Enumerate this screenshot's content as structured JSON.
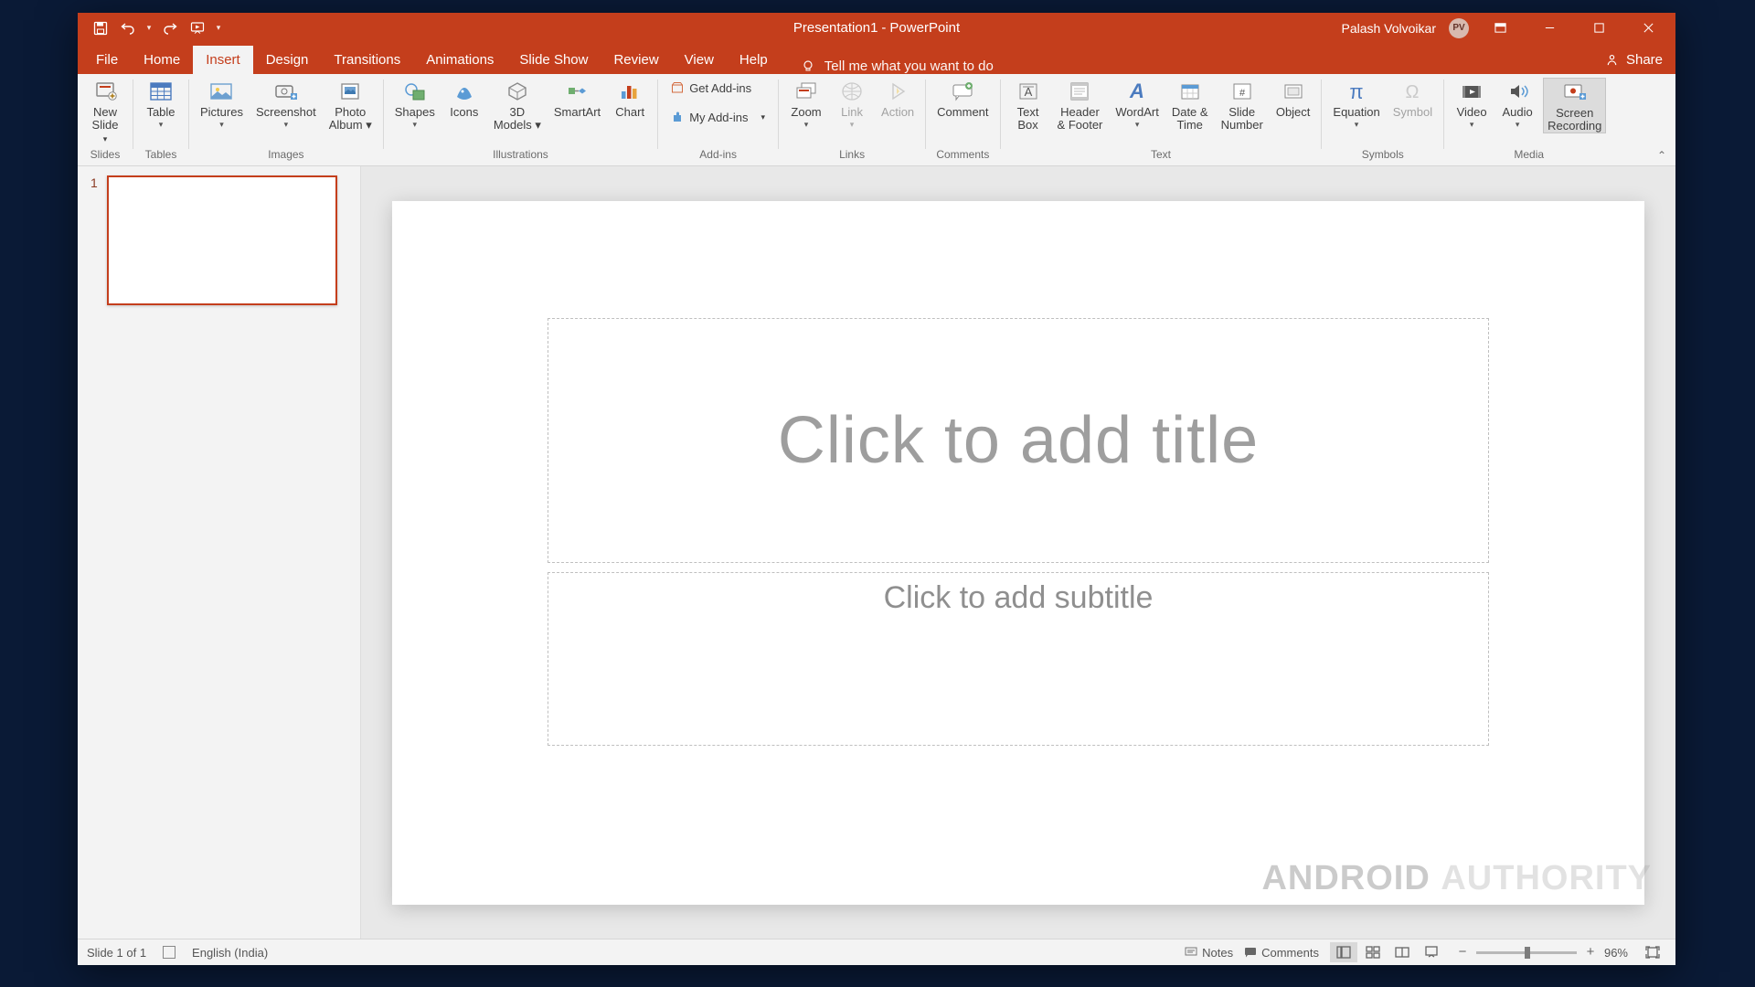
{
  "title": {
    "doc": "Presentation1",
    "sep": "-",
    "app": "PowerPoint"
  },
  "user": {
    "name": "Palash Volvoikar",
    "initials": "PV"
  },
  "qat_items": [
    "save",
    "undo",
    "redo",
    "start-from-beginning"
  ],
  "tabs": [
    "File",
    "Home",
    "Insert",
    "Design",
    "Transitions",
    "Animations",
    "Slide Show",
    "Review",
    "View",
    "Help"
  ],
  "tellme": "Tell me what you want to do",
  "share": "Share",
  "ribbon": {
    "slides": {
      "label": "Slides",
      "items": [
        {
          "label": "New",
          "sub": "Slide",
          "dd": true
        }
      ]
    },
    "tables": {
      "label": "Tables",
      "items": [
        {
          "label": "Table",
          "dd": true
        }
      ]
    },
    "images": {
      "label": "Images",
      "items": [
        {
          "label": "Pictures",
          "dd": true
        },
        {
          "label": "Screenshot",
          "dd": true
        },
        {
          "label": "Photo",
          "sub": "Album",
          "dd": true
        }
      ]
    },
    "illus": {
      "label": "Illustrations",
      "items": [
        {
          "label": "Shapes",
          "dd": true
        },
        {
          "label": "Icons"
        },
        {
          "label": "3D",
          "sub": "Models",
          "dd": true
        },
        {
          "label": "SmartArt"
        },
        {
          "label": "Chart"
        }
      ]
    },
    "addins": {
      "label": "Add-ins",
      "get": "Get Add-ins",
      "my": "My Add-ins"
    },
    "links": {
      "label": "Links",
      "items": [
        {
          "label": "Zoom",
          "dd": true
        },
        {
          "label": "Link",
          "dd": true,
          "disabled": true
        },
        {
          "label": "Action",
          "disabled": true
        }
      ]
    },
    "comments": {
      "label": "Comments",
      "items": [
        {
          "label": "Comment"
        }
      ]
    },
    "text": {
      "label": "Text",
      "items": [
        {
          "label": "Text",
          "sub": "Box"
        },
        {
          "label": "Header",
          "sub": "& Footer"
        },
        {
          "label": "WordArt",
          "dd": true
        },
        {
          "label": "Date &",
          "sub": "Time"
        },
        {
          "label": "Slide",
          "sub": "Number"
        },
        {
          "label": "Object"
        }
      ]
    },
    "symbols": {
      "label": "Symbols",
      "items": [
        {
          "label": "Equation",
          "dd": true
        },
        {
          "label": "Symbol",
          "disabled": true
        }
      ]
    },
    "media": {
      "label": "Media",
      "items": [
        {
          "label": "Video",
          "dd": true
        },
        {
          "label": "Audio",
          "dd": true
        },
        {
          "label": "Screen",
          "sub": "Recording"
        }
      ]
    }
  },
  "slide": {
    "thumbs": [
      {
        "num": "1"
      }
    ],
    "title_placeholder": "Click to add title",
    "subtitle_placeholder": "Click to add subtitle"
  },
  "status": {
    "slide": "Slide 1 of 1",
    "lang": "English (India)",
    "notes": "Notes",
    "comments": "Comments",
    "zoom": "96%"
  },
  "watermark": {
    "a": "ANDROID",
    "b": "AUTHORITY"
  }
}
